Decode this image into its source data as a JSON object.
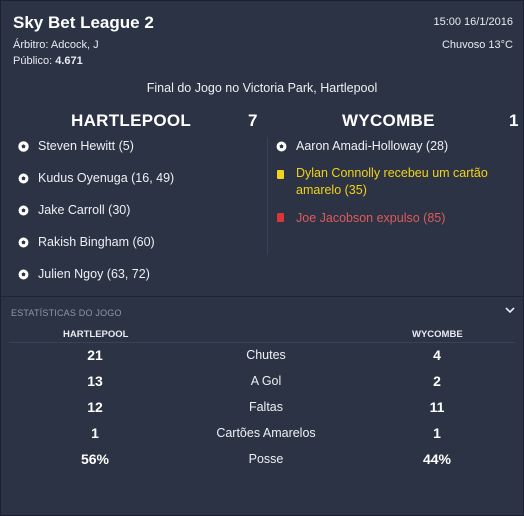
{
  "header": {
    "league": "Sky Bet League 2",
    "referee": "Árbitro: Adcock, J",
    "attendance_label": "Público:",
    "attendance_value": "4.671",
    "datetime": "15:00 16/1/2016",
    "weather": "Chuvoso 13°C"
  },
  "result_text": "Final do Jogo no Victoria Park, Hartlepool",
  "home": {
    "name": "HARTLEPOOL",
    "score": "7",
    "events": [
      {
        "type": "goal",
        "text": "Steven Hewitt (5)",
        "icon": "ball-icon"
      },
      {
        "type": "goal",
        "text": "Kudus Oyenuga (16, 49)",
        "icon": "ball-icon"
      },
      {
        "type": "goal",
        "text": "Jake Carroll (30)",
        "icon": "ball-icon"
      },
      {
        "type": "goal",
        "text": "Rakish Bingham (60)",
        "icon": "ball-icon"
      },
      {
        "type": "goal",
        "text": "Julien Ngoy (63, 72)",
        "icon": "ball-icon"
      }
    ]
  },
  "away": {
    "name": "WYCOMBE",
    "score": "1",
    "events": [
      {
        "type": "goal",
        "text": "Aaron Amadi-Holloway (28)",
        "icon": "ball-icon"
      },
      {
        "type": "yellow",
        "text": "Dylan Connolly recebeu um cartão amarelo (35)",
        "icon": "yellow-card-icon"
      },
      {
        "type": "red",
        "text": "Joe Jacobson expulso (85)",
        "icon": "red-card-icon"
      }
    ]
  },
  "stats": {
    "title": "ESTATÍSTICAS DO JOGO",
    "home_header": "HARTLEPOOL",
    "away_header": "WYCOMBE",
    "rows": [
      {
        "label": "Chutes",
        "home": "21",
        "away": "4"
      },
      {
        "label": "A Gol",
        "home": "13",
        "away": "2"
      },
      {
        "label": "Faltas",
        "home": "12",
        "away": "11"
      },
      {
        "label": "Cartões Amarelos",
        "home": "1",
        "away": "1"
      },
      {
        "label": "Posse",
        "home": "56%",
        "away": "44%"
      }
    ]
  },
  "colors": {
    "background": "#2b3344",
    "yellow_card": "#f2d21b",
    "red_text": "#e05a5a",
    "red_card": "#e03434"
  }
}
